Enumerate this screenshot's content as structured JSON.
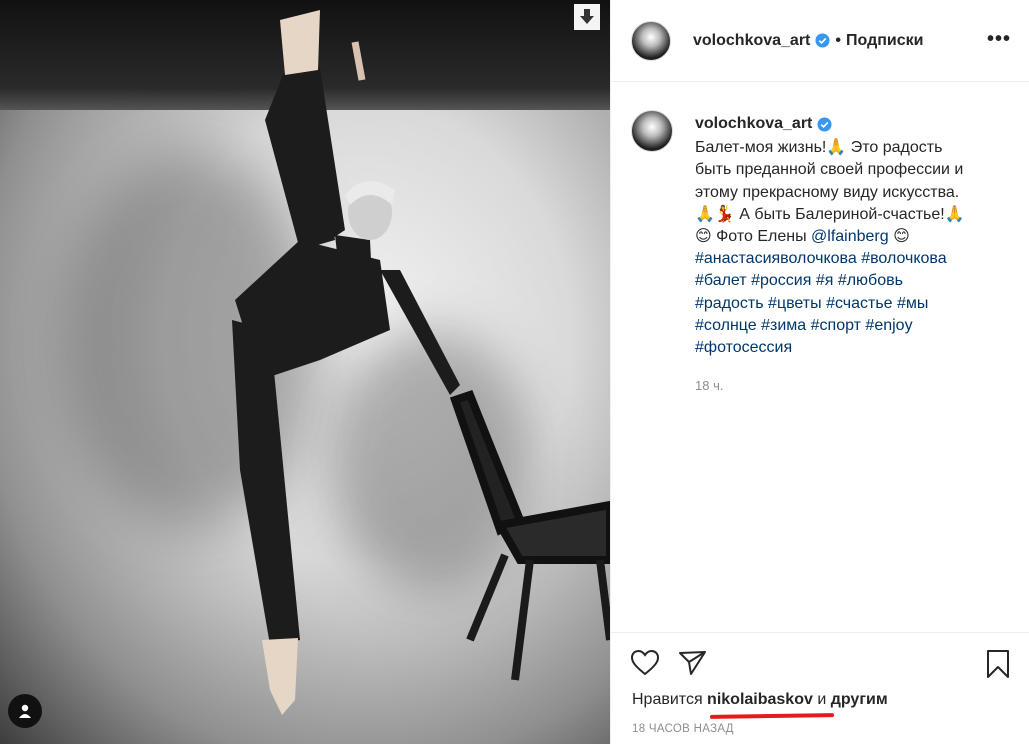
{
  "post": {
    "username": "volochkova_art",
    "follow_status": "Подписки",
    "more_label": "•••",
    "caption_lines": [
      "Балет-моя жизнь!🙏 Это радость",
      "быть преданной своей профессии и",
      "этому прекрасному виду искусства.",
      "🙏💃 А быть Балериной-счастье!🙏",
      "😊 Фото Елены "
    ],
    "mention": "@lfainberg",
    "mention_suffix": " 😊",
    "hashtag_lines": [
      "#анастасияволочкова #волочкова",
      "#балет #россия #я #любовь",
      "#радость #цветы #счастье #мы",
      "#солнце #зима #спорт #enjoy",
      "#фотосессия"
    ],
    "relative_time": "18 ч."
  },
  "likes": {
    "prefix": "Нравится ",
    "user": "nikolaibaskov",
    "connector": " и ",
    "others": "другим"
  },
  "timestamp": "18 ЧАСОВ НАЗАД",
  "icons": {
    "download": "download-arrow-icon",
    "user_tags": "user-tag-icon",
    "verified": "verified-badge-icon",
    "like": "heart-icon",
    "share": "paper-plane-icon",
    "save": "bookmark-icon"
  },
  "colors": {
    "verified": "#3897f0",
    "hashtag": "#00376b",
    "underline": "#e51b1b"
  }
}
